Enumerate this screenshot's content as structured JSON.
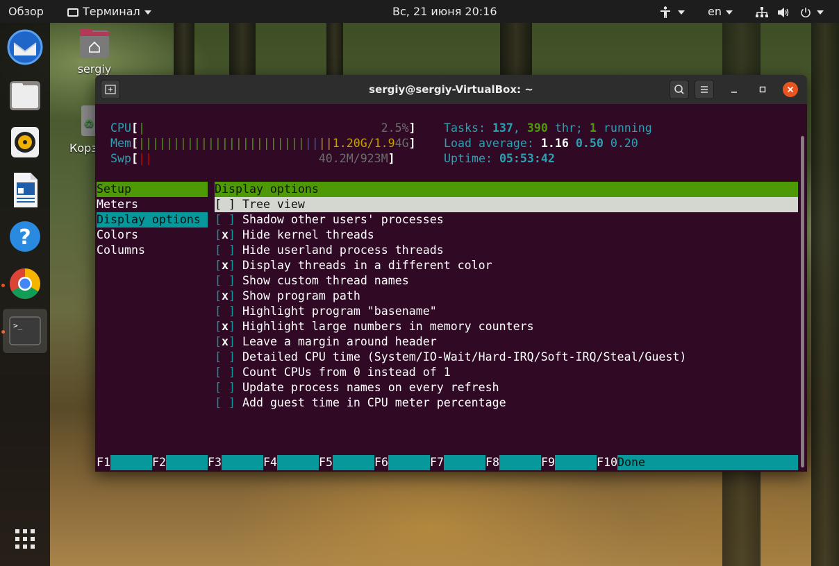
{
  "topbar": {
    "activities": "Обзор",
    "app_menu": "Терминал",
    "clock": "Вс, 21 июня  20:16",
    "language": "en"
  },
  "desktop": {
    "home_label": "sergiy",
    "trash_label": "Корз"
  },
  "terminal": {
    "title": "sergiy@sergiy-VirtualBox: ~"
  },
  "htop": {
    "meters": {
      "cpu_label": "CPU",
      "cpu_value": "2.5%",
      "mem_label": "Mem",
      "mem_value_a": "1.20G/1.9",
      "mem_value_b": "4G",
      "swp_label": "Swp",
      "swp_value": "40.2M/923M",
      "tasks_label": "Tasks: ",
      "tasks_count": "137",
      "tasks_sep": ", ",
      "threads_count": "390",
      "threads_label": " thr; ",
      "running_count": "1",
      "running_label": " running",
      "load_label": "Load average: ",
      "load_1": "1.16",
      "load_5": "0.50",
      "load_15": "0.20",
      "uptime_label": "Uptime: ",
      "uptime_value": "05:53:42"
    },
    "setup": {
      "header": "Setup",
      "items": [
        "Meters",
        "Display options",
        "Colors",
        "Columns"
      ],
      "selected": "Display options"
    },
    "panel_header": "Display options",
    "options": [
      {
        "checked": " ",
        "label": "Tree view"
      },
      {
        "checked": " ",
        "label": "Shadow other users' processes"
      },
      {
        "checked": "x",
        "label": "Hide kernel threads"
      },
      {
        "checked": " ",
        "label": "Hide userland process threads"
      },
      {
        "checked": "x",
        "label": "Display threads in a different color"
      },
      {
        "checked": " ",
        "label": "Show custom thread names"
      },
      {
        "checked": "x",
        "label": "Show program path"
      },
      {
        "checked": " ",
        "label": "Highlight program \"basename\""
      },
      {
        "checked": "x",
        "label": "Highlight large numbers in memory counters"
      },
      {
        "checked": "x",
        "label": "Leave a margin around header"
      },
      {
        "checked": " ",
        "label": "Detailed CPU time (System/IO-Wait/Hard-IRQ/Soft-IRQ/Steal/Guest)"
      },
      {
        "checked": " ",
        "label": "Count CPUs from 0 instead of 1"
      },
      {
        "checked": " ",
        "label": "Update process names on every refresh"
      },
      {
        "checked": " ",
        "label": "Add guest time in CPU meter percentage"
      }
    ],
    "fkeys": [
      {
        "key": "F1",
        "label": ""
      },
      {
        "key": "F2",
        "label": ""
      },
      {
        "key": "F3",
        "label": ""
      },
      {
        "key": "F4",
        "label": ""
      },
      {
        "key": "F5",
        "label": ""
      },
      {
        "key": "F6",
        "label": ""
      },
      {
        "key": "F7",
        "label": ""
      },
      {
        "key": "F8",
        "label": ""
      },
      {
        "key": "F9",
        "label": ""
      },
      {
        "key": "F10",
        "label": "Done"
      }
    ]
  },
  "colors": {
    "terminal_bg": "#300a24",
    "header_green": "#4e9a06",
    "selection_cyan": "#06989a",
    "highlight_row": "#d3d7cf",
    "ubuntu_orange": "#e95420"
  }
}
